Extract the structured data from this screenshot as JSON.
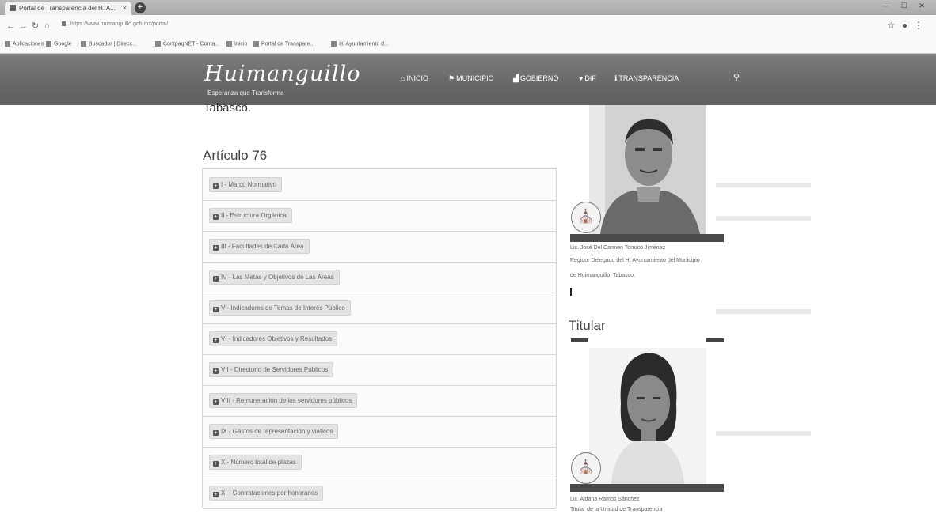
{
  "browser": {
    "tab_title": "Portal de Transparencia del H. A...",
    "tab_close": "×",
    "new_tab": "+",
    "window_controls": "— ☐ ✕",
    "url": "https://www.huimanguillo.gob.mx/portal/",
    "bookmarks": [
      "Aplicaciones",
      "Google",
      "Buscador | Direcc...",
      "ContpaqNET - Conta...",
      "Inicio",
      "Portal de Transpare...",
      "H. Ayuntamiento d..."
    ]
  },
  "site": {
    "logo": "Huimanguillo",
    "slogan": "Esperanza que Transforma",
    "nav": [
      {
        "icon": "home-icon",
        "glyph": "⌂",
        "label": "INICIO"
      },
      {
        "icon": "flag-icon",
        "glyph": "⚑",
        "label": "MUNICIPIO"
      },
      {
        "icon": "building-icon",
        "glyph": "▟",
        "label": "GOBIERNO"
      },
      {
        "icon": "heart-icon",
        "glyph": "♥",
        "label": "DIF"
      },
      {
        "icon": "info-icon",
        "glyph": "ℹ",
        "label": "TRANSPARENCIA"
      }
    ],
    "search_glyph": "⚲"
  },
  "content": {
    "prev_text": "Tabasco.",
    "article_title": "Artículo 76",
    "items": [
      "I - Marco Normativo",
      "II - Estructura Orgánica",
      "III - Facultades de Cada Área",
      "IV - Las Metas y Objetivos de Las Áreas",
      "V - Indicadores de Temas de Interés Público",
      "VI - Indicadores Objetivos y Resultados",
      "VII - Directorio de Servidores Públicos",
      "VIII - Remuneración de los servidores públicos",
      "IX - Gastos de representación y viáticos",
      "X - Número total de plazas",
      "XI - Contrataciones por honorarios"
    ]
  },
  "sidebar": {
    "official": {
      "name": "Lic. José Del Carmen Torruco Jiménez",
      "role_line1": "Regidor Delegado del H. Ayuntamiento del Municipio",
      "role_line2": "de Huimanguillo, Tabasco."
    },
    "section_title": "Titular",
    "titular": {
      "name": "Lic. Aidana Ramos Sánchez",
      "role": "Titular de la Unidad de Transparencia"
    }
  },
  "colors": {
    "header_bg": "#6f6f6f",
    "pill_bg": "#e4e4e4",
    "caption_bar": "#4a4a4a"
  }
}
